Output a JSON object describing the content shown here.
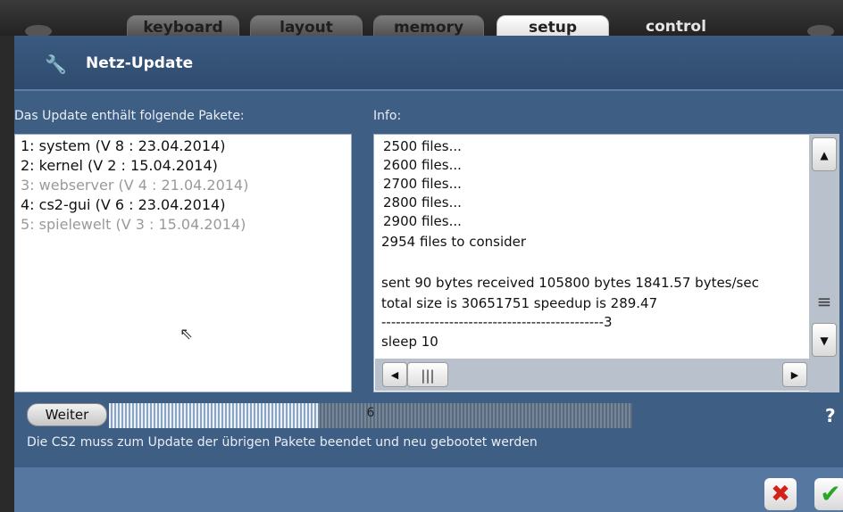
{
  "tabs": [
    {
      "label": "keyboard",
      "active": false
    },
    {
      "label": "layout",
      "active": false
    },
    {
      "label": "memory",
      "active": false
    },
    {
      "label": "setup",
      "active": true
    },
    {
      "label": "control",
      "active": false
    }
  ],
  "dialog": {
    "title": "Netz-Update",
    "icon": "wrench-icon"
  },
  "packages": {
    "label": "Das Update enthält folgende Pakete:",
    "items": [
      {
        "text": "1: system (V 8 : 23.04.2014)",
        "enabled": true
      },
      {
        "text": "2: kernel (V 2 : 15.04.2014)",
        "enabled": true
      },
      {
        "text": "3: webserver (V 4 : 21.04.2014)",
        "enabled": false
      },
      {
        "text": "4: cs2-gui (V 6 : 23.04.2014)",
        "enabled": true
      },
      {
        "text": "5: spielewelt (V 3 : 15.04.2014)",
        "enabled": false
      }
    ]
  },
  "info": {
    "label": "Info:",
    "lines": [
      " 2500 files...",
      " 2600 files...",
      " 2700 files...",
      " 2800 files...",
      " 2900 files...",
      "2954 files to consider",
      "",
      "sent 90 bytes  received 105800 bytes  1841.57 bytes/sec",
      "total size is 30651751  speedup is 289.47",
      "----------------------------------------------3",
      "sleep 10"
    ]
  },
  "controls": {
    "weiter_label": "Weiter",
    "progress_label": "6",
    "progress_fraction": 0.4,
    "help_label": "?"
  },
  "status_text": "Die CS2 muss zum Update der übrigen Pakete beendet und neu gebootet werden",
  "colors": {
    "cancel": "#d4211a",
    "ok": "#2aa52a",
    "dialog_bg": "#3f5e84"
  }
}
